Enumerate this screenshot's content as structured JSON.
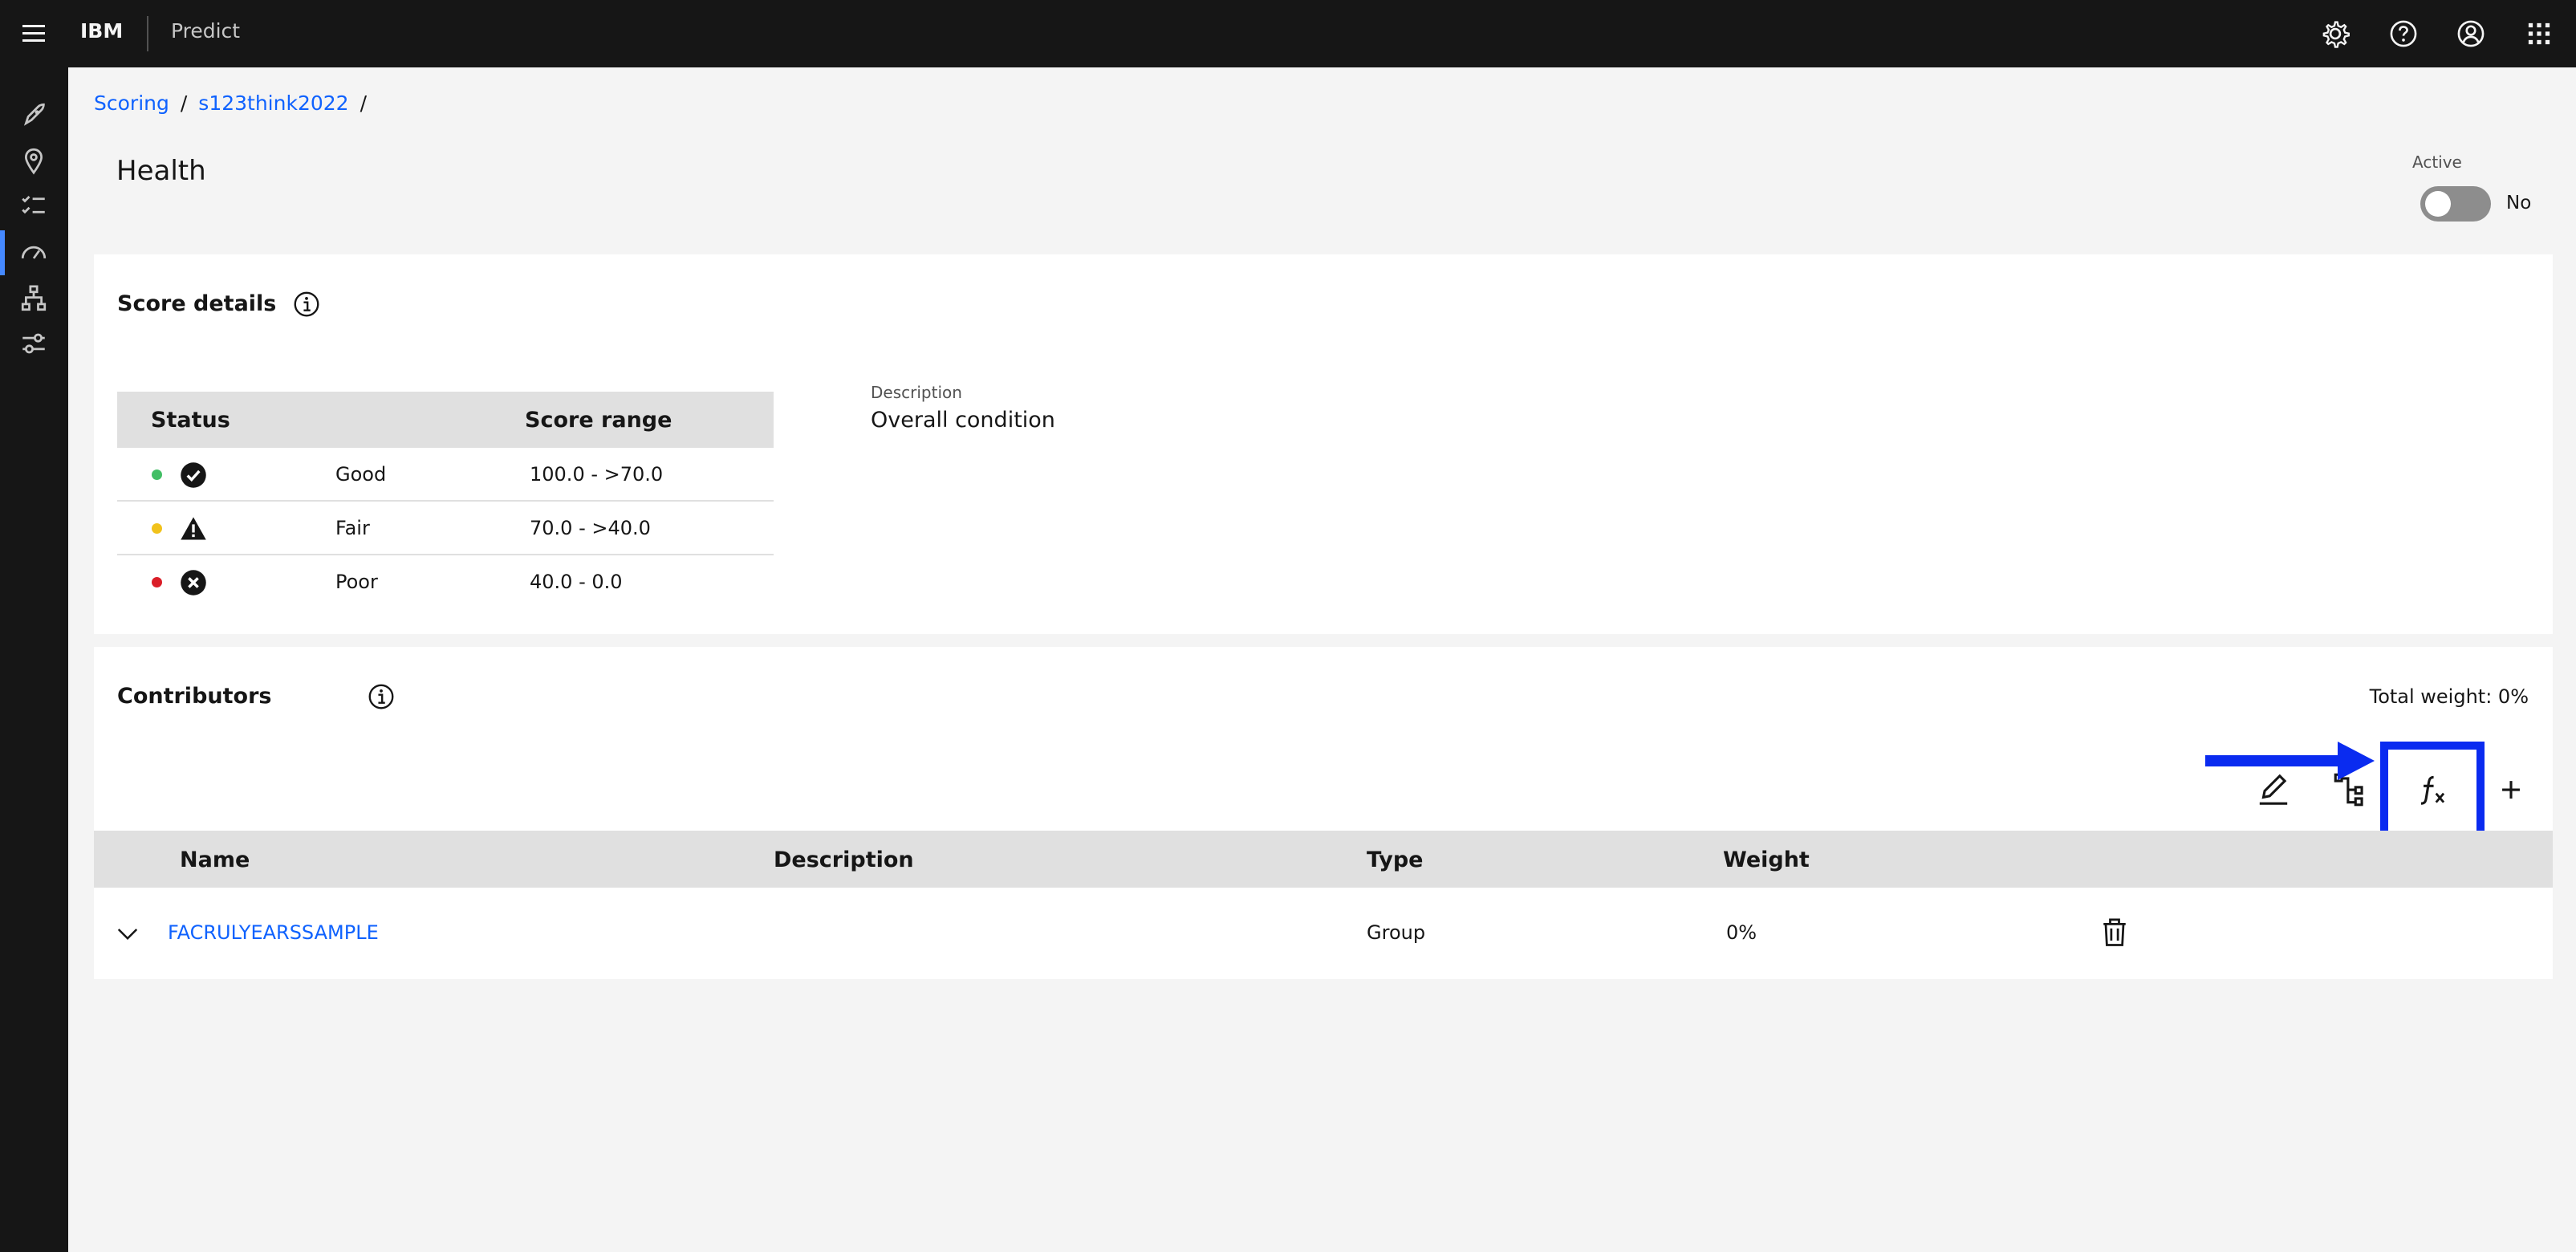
{
  "header": {
    "brand": "IBM",
    "product": "Predict"
  },
  "breadcrumb": {
    "items": [
      "Scoring",
      "s123think2022"
    ],
    "separator": "/"
  },
  "page": {
    "title": "Health"
  },
  "active_toggle": {
    "label": "Active",
    "state": "No"
  },
  "score_details": {
    "title": "Score details",
    "table": {
      "headers": {
        "status": "Status",
        "range": "Score range"
      },
      "rows": [
        {
          "label": "Good",
          "range": "100.0 - >70.0",
          "color": "#42be65",
          "icon": "checkmark-filled-icon"
        },
        {
          "label": "Fair",
          "range": "70.0 - >40.0",
          "color": "#f1c21b",
          "icon": "warning-filled-icon"
        },
        {
          "label": "Poor",
          "range": "40.0 - 0.0",
          "color": "#da1e28",
          "icon": "error-filled-icon"
        }
      ]
    },
    "description": {
      "label": "Description",
      "value": "Overall condition"
    }
  },
  "contributors": {
    "title": "Contributors",
    "total_weight": "Total weight: 0%",
    "table": {
      "headers": {
        "name": "Name",
        "description": "Description",
        "type": "Type",
        "weight": "Weight"
      },
      "rows": [
        {
          "name": "FACRULYEARSSAMPLE",
          "description": "",
          "type": "Group",
          "weight": "0%"
        }
      ]
    }
  },
  "colors": {
    "link": "#0f62fe",
    "highlight": "#0a2bf0",
    "header_bg": "#161616",
    "table_header": "#e0e0e0"
  }
}
